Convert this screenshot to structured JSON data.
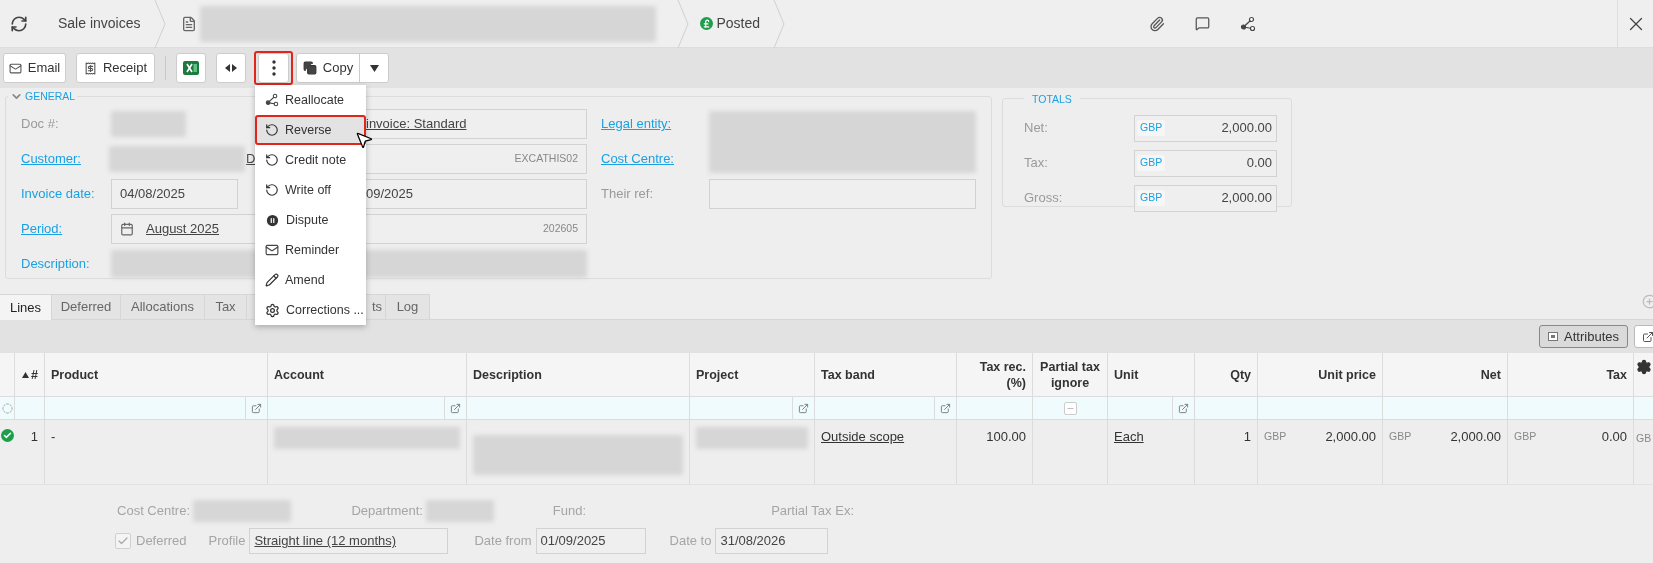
{
  "header": {
    "breadcrumb": "Sale invoices",
    "status": "Posted"
  },
  "toolbar": {
    "email": "Email",
    "receipt": "Receipt",
    "more_highlighted": true,
    "copy": "Copy"
  },
  "menu": {
    "items": [
      {
        "label": "Reallocate",
        "hovered": false,
        "highlighted": false
      },
      {
        "label": "Reverse",
        "hovered": true,
        "highlighted": true
      },
      {
        "label": "Credit note",
        "hovered": false,
        "highlighted": false
      },
      {
        "label": "Write off",
        "hovered": false,
        "highlighted": false
      },
      {
        "label": "Dispute",
        "hovered": false,
        "highlighted": false
      },
      {
        "label": "Reminder",
        "hovered": false,
        "highlighted": false
      },
      {
        "label": "Amend",
        "hovered": false,
        "highlighted": false
      },
      {
        "label": "Corrections ...",
        "hovered": false,
        "highlighted": false
      }
    ]
  },
  "general": {
    "title": "GENERAL",
    "expanded": true,
    "doc": {
      "label": {
        "text": "Doc #:",
        "kind": "plain"
      }
    },
    "type_value": "invoice: Standard",
    "legal_entity": {
      "label": {
        "text": "Legal entity:",
        "kind": "link"
      }
    },
    "customer": {
      "label": {
        "text": "Customer:",
        "kind": "link"
      },
      "fragment": "D"
    },
    "code_value": "EXCATHIS02",
    "cost_centre": {
      "label": {
        "text": "Cost Centre:",
        "kind": "link"
      }
    },
    "invoice_date": {
      "label": {
        "text": "Invoice date:",
        "kind": "accent"
      },
      "value": "04/08/2025"
    },
    "due_fragment": "09/2025",
    "their_ref": {
      "label": {
        "text": "Their ref:",
        "kind": "plain"
      }
    },
    "period": {
      "label": {
        "text": "Period:",
        "kind": "link"
      },
      "value": "August 2025",
      "code": "202605"
    },
    "description": {
      "label": {
        "text": "Description:",
        "kind": "accent"
      }
    }
  },
  "totals": {
    "title": "TOTALS",
    "rows": [
      {
        "label": "Net:",
        "currency": "GBP",
        "value": "2,000.00"
      },
      {
        "label": "Tax:",
        "currency": "GBP",
        "value": "0.00"
      },
      {
        "label": "Gross:",
        "currency": "GBP",
        "value": "2,000.00"
      }
    ]
  },
  "tabs": [
    {
      "label": "Lines",
      "selected": true
    },
    {
      "label": "Deferred",
      "selected": false
    },
    {
      "label": "Allocations",
      "selected": false
    },
    {
      "label": "Tax",
      "selected": false
    },
    {
      "label": "ts",
      "selected": false
    },
    {
      "label": "Log",
      "selected": false
    }
  ],
  "grid": {
    "attributes": "Attributes",
    "columns": [
      {
        "label": "#",
        "kind": "plain",
        "sorted": true
      },
      {
        "label": "Product",
        "kind": "popout",
        "sorted": false
      },
      {
        "label": "Account",
        "kind": "popout",
        "sorted": false
      },
      {
        "label": "Description",
        "kind": "plain",
        "sorted": false
      },
      {
        "label": "Project",
        "kind": "popout",
        "sorted": false
      },
      {
        "label": "Tax band",
        "kind": "popout",
        "sorted": false
      },
      {
        "label": "Tax rec. (%)",
        "kind": "plain",
        "sorted": false
      },
      {
        "label": "Partial tax ignore",
        "kind": "toggle",
        "sorted": false
      },
      {
        "label": "Unit",
        "kind": "popout",
        "sorted": false
      },
      {
        "label": "Qty",
        "kind": "plain",
        "sorted": false
      },
      {
        "label": "Unit price",
        "kind": "plain",
        "sorted": false
      },
      {
        "label": "Net",
        "kind": "plain",
        "sorted": false
      },
      {
        "label": "Tax",
        "kind": "plain",
        "sorted": false
      }
    ],
    "rows": [
      {
        "valid": true,
        "overflow": "GB",
        "cells": [
          {
            "kind": "text",
            "value": "1"
          },
          {
            "kind": "text",
            "value": "-"
          },
          {
            "kind": "blurred"
          },
          {
            "kind": "blurred"
          },
          {
            "kind": "blurred"
          },
          {
            "kind": "link",
            "value": "Outside scope"
          },
          {
            "kind": "text",
            "value": "100.00"
          },
          {
            "kind": "empty"
          },
          {
            "kind": "link",
            "value": "Each"
          },
          {
            "kind": "text",
            "value": "1"
          },
          {
            "kind": "money",
            "currency": "GBP",
            "value": "2,000.00"
          },
          {
            "kind": "money",
            "currency": "GBP",
            "value": "2,000.00"
          },
          {
            "kind": "money",
            "currency": "GBP",
            "value": "0.00"
          }
        ]
      }
    ]
  },
  "detail": {
    "cost_centre": "Cost Centre:",
    "department": "Department:",
    "fund": "Fund:",
    "partial_tax": "Partial Tax Ex:",
    "deferred": {
      "label": "Deferred",
      "checked": true
    },
    "profile_label": "Profile",
    "profile": "Straight line (12 months)",
    "date_from_label": "Date from",
    "date_from": "01/09/2025",
    "date_to_label": "Date to",
    "date_to": "31/08/2026"
  }
}
